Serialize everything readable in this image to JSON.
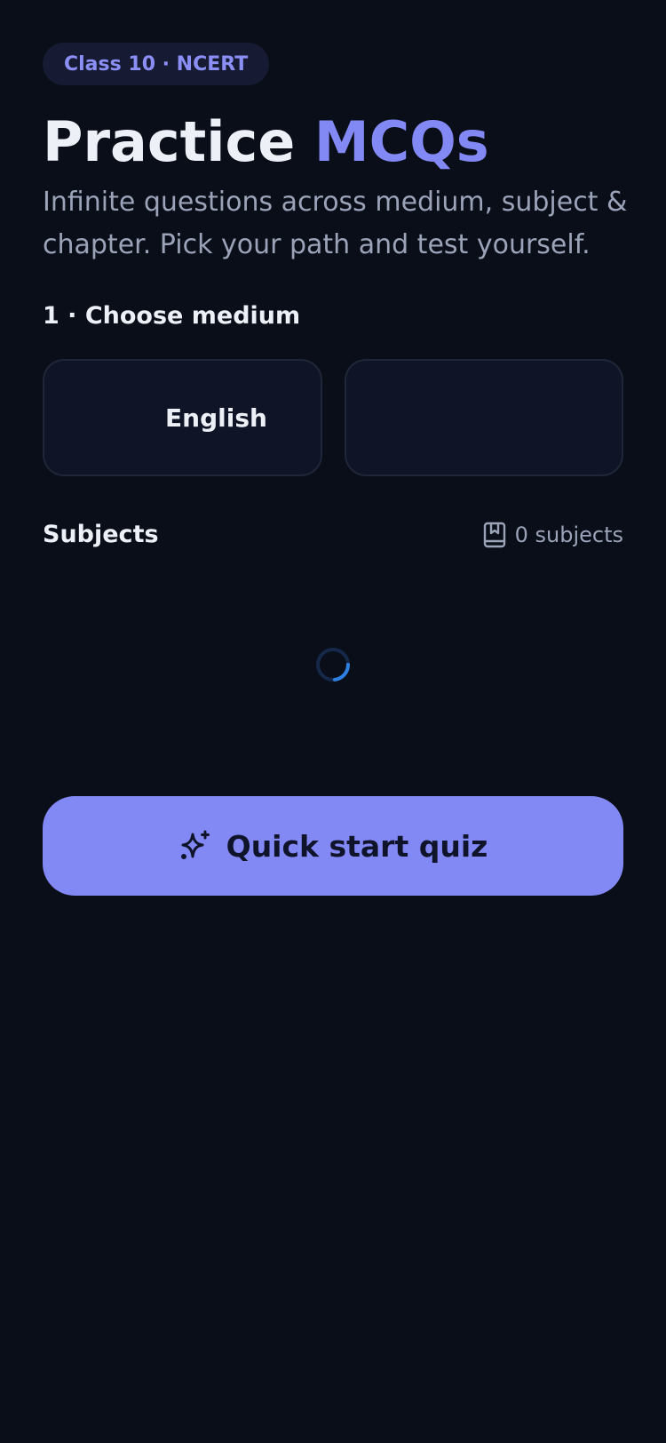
{
  "header": {
    "badge": "Class 10 · NCERT",
    "title_main": "Practice",
    "title_accent": "MCQs",
    "subtitle": "Infinite questions across medium, subject & chapter. Pick your path and test yourself."
  },
  "medium": {
    "section_label": "1 · Choose medium",
    "options": [
      {
        "label": "English"
      },
      {
        "label": ""
      }
    ]
  },
  "subjects": {
    "title": "Subjects",
    "count_label": "0 subjects",
    "icon": "book-bookmark-icon",
    "loading": true
  },
  "actions": {
    "quick_start_label": "Quick start quiz",
    "quick_start_icon": "sparkles-icon"
  },
  "colors": {
    "background": "#0a0e19",
    "accent": "#8289f4",
    "card": "#0f1526",
    "badge_bg": "#161b33",
    "muted_text": "#9aa3b8",
    "spinner": "#2f7fe0"
  }
}
